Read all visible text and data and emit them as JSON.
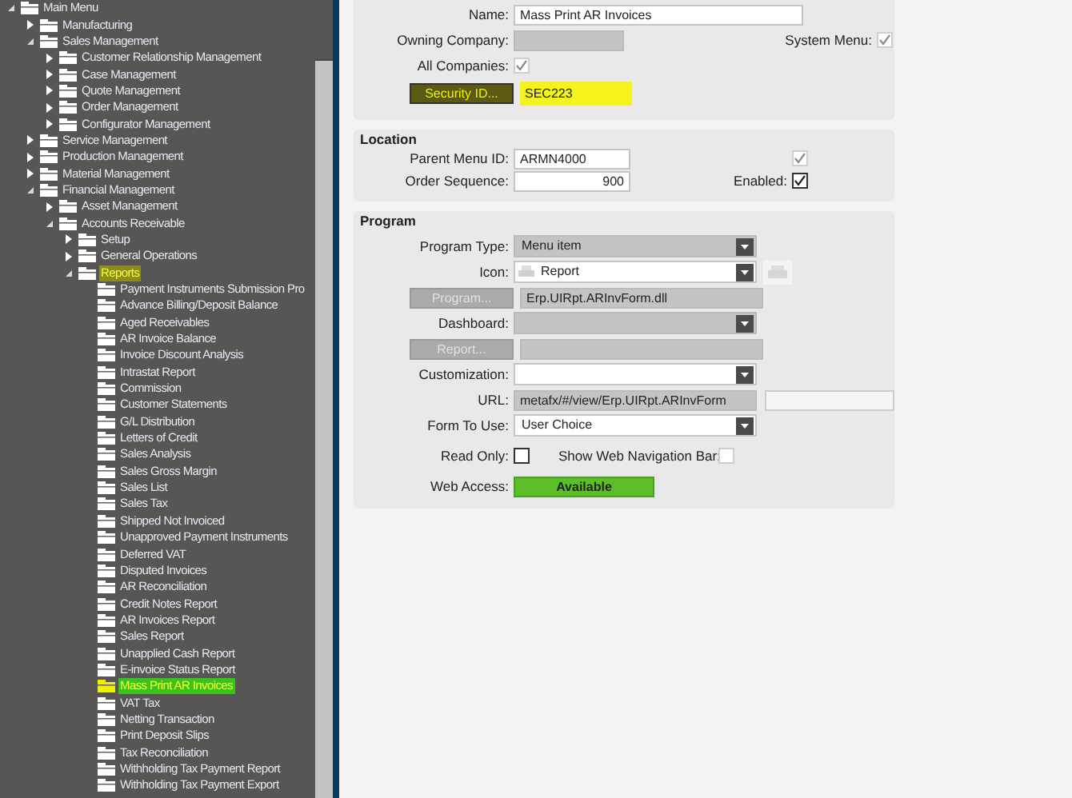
{
  "tree": [
    {
      "label": "Main Menu",
      "expanded": true,
      "selected": false,
      "marked": false,
      "children": [
        {
          "label": "Manufacturing",
          "expanded": false,
          "selected": false,
          "marked": false
        },
        {
          "label": "Sales Management",
          "expanded": true,
          "selected": false,
          "marked": false,
          "children": [
            {
              "label": "Customer Relationship Management",
              "expanded": false,
              "selected": false,
              "marked": false
            },
            {
              "label": "Case Management",
              "expanded": false,
              "selected": false,
              "marked": false
            },
            {
              "label": "Quote Management",
              "expanded": false,
              "selected": false,
              "marked": false
            },
            {
              "label": "Order Management",
              "expanded": false,
              "selected": false,
              "marked": false
            },
            {
              "label": "Configurator Management",
              "expanded": false,
              "selected": false,
              "marked": false
            }
          ]
        },
        {
          "label": "Service Management",
          "expanded": false,
          "selected": false,
          "marked": false
        },
        {
          "label": "Production Management",
          "expanded": false,
          "selected": false,
          "marked": false
        },
        {
          "label": "Material Management",
          "expanded": false,
          "selected": false,
          "marked": false
        },
        {
          "label": "Financial Management",
          "expanded": true,
          "selected": false,
          "marked": false,
          "children": [
            {
              "label": "Asset Management",
              "expanded": false,
              "selected": false,
              "marked": false
            },
            {
              "label": "Accounts Receivable",
              "expanded": true,
              "selected": false,
              "marked": false,
              "children": [
                {
                  "label": "Setup",
                  "expanded": false,
                  "selected": false,
                  "marked": false
                },
                {
                  "label": "General Operations",
                  "expanded": false,
                  "selected": false,
                  "marked": false
                },
                {
                  "label": "Reports",
                  "expanded": true,
                  "selected": false,
                  "marked": true,
                  "children": [
                    {
                      "label": "Payment Instruments Submission Pro",
                      "selected": false,
                      "marked": false
                    },
                    {
                      "label": "Advance Billing/Deposit Balance",
                      "selected": false,
                      "marked": false
                    },
                    {
                      "label": "Aged Receivables",
                      "selected": false,
                      "marked": false
                    },
                    {
                      "label": "AR Invoice Balance",
                      "selected": false,
                      "marked": false
                    },
                    {
                      "label": "Invoice Discount Analysis",
                      "selected": false,
                      "marked": false
                    },
                    {
                      "label": "Intrastat Report",
                      "selected": false,
                      "marked": false
                    },
                    {
                      "label": "Commission",
                      "selected": false,
                      "marked": false
                    },
                    {
                      "label": "Customer Statements",
                      "selected": false,
                      "marked": false
                    },
                    {
                      "label": "G/L Distribution",
                      "selected": false,
                      "marked": false
                    },
                    {
                      "label": "Letters of Credit",
                      "selected": false,
                      "marked": false
                    },
                    {
                      "label": "Sales Analysis",
                      "selected": false,
                      "marked": false
                    },
                    {
                      "label": "Sales Gross Margin",
                      "selected": false,
                      "marked": false
                    },
                    {
                      "label": "Sales List",
                      "selected": false,
                      "marked": false
                    },
                    {
                      "label": "Sales Tax",
                      "selected": false,
                      "marked": false
                    },
                    {
                      "label": "Shipped Not Invoiced",
                      "selected": false,
                      "marked": false
                    },
                    {
                      "label": "Unapproved Payment Instruments",
                      "selected": false,
                      "marked": false
                    },
                    {
                      "label": "Deferred VAT",
                      "selected": false,
                      "marked": false
                    },
                    {
                      "label": "Disputed Invoices",
                      "selected": false,
                      "marked": false
                    },
                    {
                      "label": "AR Reconciliation",
                      "selected": false,
                      "marked": false
                    },
                    {
                      "label": "Credit Notes Report",
                      "selected": false,
                      "marked": false
                    },
                    {
                      "label": "AR Invoices Report",
                      "selected": false,
                      "marked": false
                    },
                    {
                      "label": "Sales Report",
                      "selected": false,
                      "marked": false
                    },
                    {
                      "label": "Unapplied Cash Report",
                      "selected": false,
                      "marked": false
                    },
                    {
                      "label": "E-invoice Status Report",
                      "selected": false,
                      "marked": false
                    },
                    {
                      "label": "Mass Print AR Invoices",
                      "selected": true,
                      "marked": true
                    },
                    {
                      "label": "VAT Tax",
                      "selected": false,
                      "marked": false
                    },
                    {
                      "label": "Netting Transaction",
                      "selected": false,
                      "marked": false
                    },
                    {
                      "label": "Print Deposit Slips",
                      "selected": false,
                      "marked": false
                    },
                    {
                      "label": "Tax Reconciliation",
                      "selected": false,
                      "marked": false
                    },
                    {
                      "label": "Withholding Tax Payment Report",
                      "selected": false,
                      "marked": false
                    },
                    {
                      "label": "Withholding Tax Payment Export",
                      "selected": false,
                      "marked": false
                    }
                  ]
                }
              ]
            }
          ]
        }
      ]
    }
  ],
  "general": {
    "name": {
      "label": "Name:",
      "value": "Mass Print AR Invoices"
    },
    "owning_company": {
      "label": "Owning Company:",
      "disabled": true
    },
    "system_menu": {
      "label": "System Menu:",
      "checked": true,
      "disabled": true
    },
    "all_companies": {
      "label": "All Companies:",
      "checked": true,
      "disabled": true
    },
    "security_id": {
      "button": "Security ID...",
      "value": "SEC223",
      "marked": true
    }
  },
  "location": {
    "title": "Location",
    "parent_menu_id": {
      "label": "Parent Menu ID:",
      "value": "ARMN4000"
    },
    "unlabeled_check": {
      "checked": true,
      "disabled": true
    },
    "order_sequence": {
      "label": "Order Sequence:",
      "value": "900"
    },
    "enabled": {
      "label": "Enabled:",
      "checked": true,
      "disabled": false
    }
  },
  "program": {
    "title": "Program",
    "program_type": {
      "label": "Program Type:",
      "value": "Menu item",
      "disabled": true
    },
    "icon": {
      "label": "Icon:",
      "value": "Report",
      "disabled": false
    },
    "program": {
      "button": "Program...",
      "disabled": true,
      "value": "Erp.UIRpt.ARInvForm.dll"
    },
    "dashboard": {
      "label": "Dashboard:",
      "disabled": true
    },
    "report": {
      "button": "Report...",
      "disabled": true
    },
    "customization": {
      "label": "Customization:",
      "disabled": false
    },
    "url": {
      "label": "URL:",
      "value": "metafx/#/view/Erp.UIRpt.ARInvForm"
    },
    "form_to_use": {
      "label": "Form To Use:",
      "value": "User Choice",
      "disabled": false
    },
    "read_only": {
      "label": "Read Only:",
      "checked": false,
      "disabled": false
    },
    "show_web_nav": {
      "label": "Show Web Navigation Bar:",
      "checked": false,
      "disabled": true
    },
    "web_access": {
      "label": "Web Access:",
      "status": "Available"
    }
  }
}
